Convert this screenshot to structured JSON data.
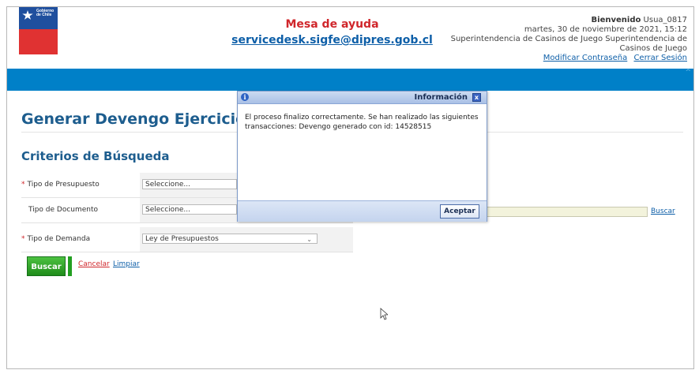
{
  "header": {
    "logo_text_line1": "Gobierno",
    "logo_text_line2": "de Chile",
    "helpdesk_title": "Mesa de ayuda",
    "helpdesk_email": "servicedesk.sigfe@dipres.gob.cl",
    "welcome_label": "Bienvenido",
    "username": "Usua_0817",
    "date_time": "martes, 30 de noviembre de 2021, 15:12",
    "organization": "Superintendencia de Casinos de Juego Superintendencia de Casinos de Juego",
    "change_password_link": "Modificar Contraseña",
    "logout_link": "Cerrar Sesión"
  },
  "page": {
    "title": "Generar Devengo Ejercicio An",
    "section_title": "Criterios de Búsqueda",
    "required_mark": "*"
  },
  "form": {
    "tipo_presupuesto": {
      "label": "Tipo de Presupuesto",
      "value": "Seleccione..."
    },
    "tipo_documento": {
      "label": "Tipo de Documento",
      "value": "Seleccione...",
      "search_link": "Buscar"
    },
    "tipo_demanda": {
      "label": "Tipo de Demanda",
      "value": "Ley de Presupuestos"
    },
    "buttons": {
      "search": "Buscar",
      "cancel": "Cancelar",
      "clear": "Limpiar"
    }
  },
  "dialog": {
    "title": "Información",
    "icon": "info-icon",
    "message": "El proceso finalizo correctamente. Se han realizado las siguientes transacciones: Devengo generado con id: 14528515",
    "ok_button": "Aceptar",
    "close_glyph": "x"
  },
  "colors": {
    "brand_blue": "#0080c8",
    "title_blue": "#1d5d8e",
    "link_blue": "#0e5fa8",
    "red": "#d0262b",
    "button_green": "#1f8c1a"
  }
}
